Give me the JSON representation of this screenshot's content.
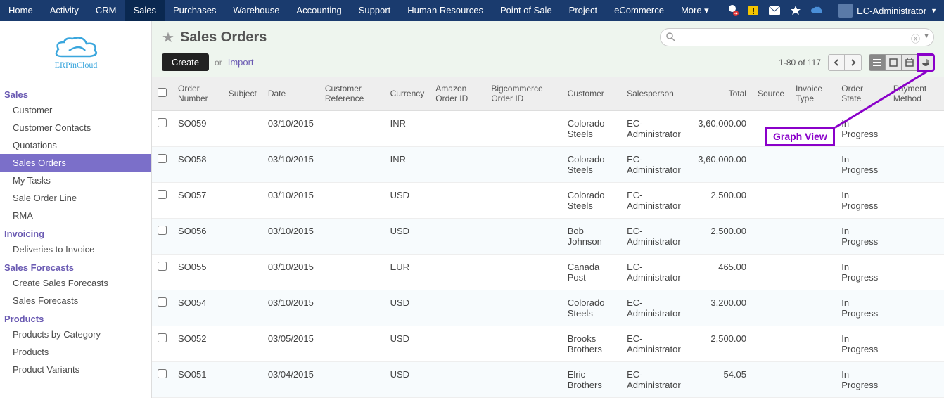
{
  "topnav": {
    "items": [
      "Home",
      "Activity",
      "CRM",
      "Sales",
      "Purchases",
      "Warehouse",
      "Accounting",
      "Support",
      "Human Resources",
      "Point of Sale",
      "Project",
      "eCommerce",
      "More"
    ],
    "active_index": 3,
    "user": "EC-Administrator"
  },
  "logo_text": "ERPinCloud",
  "sidebar": {
    "groups": [
      {
        "heading": "Sales",
        "items": [
          "Customer",
          "Customer Contacts",
          "Quotations",
          "Sales Orders",
          "My Tasks",
          "Sale Order Line",
          "RMA"
        ],
        "active_index": 3
      },
      {
        "heading": "Invoicing",
        "items": [
          "Deliveries to Invoice"
        ]
      },
      {
        "heading": "Sales Forecasts",
        "items": [
          "Create Sales Forecasts",
          "Sales Forecasts"
        ]
      },
      {
        "heading": "Products",
        "items": [
          "Products by Category",
          "Products",
          "Product Variants"
        ]
      }
    ]
  },
  "page": {
    "title": "Sales Orders",
    "create_label": "Create",
    "or_label": "or",
    "import_label": "Import",
    "pager": "1-80 of 117",
    "search_placeholder": ""
  },
  "annotation": {
    "label": "Graph View"
  },
  "columns": [
    "",
    "Order Number",
    "Subject",
    "Date",
    "Customer Reference",
    "Currency",
    "Amazon Order ID",
    "Bigcommerce Order ID",
    "Customer",
    "Salesperson",
    "Total",
    "Source",
    "Invoice Type",
    "Order State",
    "Payment Method"
  ],
  "rows": [
    {
      "order": "SO059",
      "subject": "",
      "date": "03/10/2015",
      "custref": "",
      "currency": "INR",
      "amazon": "",
      "bigcom": "",
      "customer": "Colorado Steels",
      "sales": "EC-Administrator",
      "total": "3,60,000.00",
      "source": "",
      "invtype": "",
      "state": "In Progress",
      "pay": ""
    },
    {
      "order": "SO058",
      "subject": "",
      "date": "03/10/2015",
      "custref": "",
      "currency": "INR",
      "amazon": "",
      "bigcom": "",
      "customer": "Colorado Steels",
      "sales": "EC-Administrator",
      "total": "3,60,000.00",
      "source": "",
      "invtype": "",
      "state": "In Progress",
      "pay": ""
    },
    {
      "order": "SO057",
      "subject": "",
      "date": "03/10/2015",
      "custref": "",
      "currency": "USD",
      "amazon": "",
      "bigcom": "",
      "customer": "Colorado Steels",
      "sales": "EC-Administrator",
      "total": "2,500.00",
      "source": "",
      "invtype": "",
      "state": "In Progress",
      "pay": ""
    },
    {
      "order": "SO056",
      "subject": "",
      "date": "03/10/2015",
      "custref": "",
      "currency": "USD",
      "amazon": "",
      "bigcom": "",
      "customer": "Bob Johnson",
      "sales": "EC-Administrator",
      "total": "2,500.00",
      "source": "",
      "invtype": "",
      "state": "In Progress",
      "pay": ""
    },
    {
      "order": "SO055",
      "subject": "",
      "date": "03/10/2015",
      "custref": "",
      "currency": "EUR",
      "amazon": "",
      "bigcom": "",
      "customer": "Canada Post",
      "sales": "EC-Administrator",
      "total": "465.00",
      "source": "",
      "invtype": "",
      "state": "In Progress",
      "pay": ""
    },
    {
      "order": "SO054",
      "subject": "",
      "date": "03/10/2015",
      "custref": "",
      "currency": "USD",
      "amazon": "",
      "bigcom": "",
      "customer": "Colorado Steels",
      "sales": "EC-Administrator",
      "total": "3,200.00",
      "source": "",
      "invtype": "",
      "state": "In Progress",
      "pay": ""
    },
    {
      "order": "SO052",
      "subject": "",
      "date": "03/05/2015",
      "custref": "",
      "currency": "USD",
      "amazon": "",
      "bigcom": "",
      "customer": "Brooks Brothers",
      "sales": "EC-Administrator",
      "total": "2,500.00",
      "source": "",
      "invtype": "",
      "state": "In Progress",
      "pay": ""
    },
    {
      "order": "SO051",
      "subject": "",
      "date": "03/04/2015",
      "custref": "",
      "currency": "USD",
      "amazon": "",
      "bigcom": "",
      "customer": "Elric Brothers",
      "sales": "EC-Administrator",
      "total": "54.05",
      "source": "",
      "invtype": "",
      "state": "In Progress",
      "pay": ""
    }
  ]
}
